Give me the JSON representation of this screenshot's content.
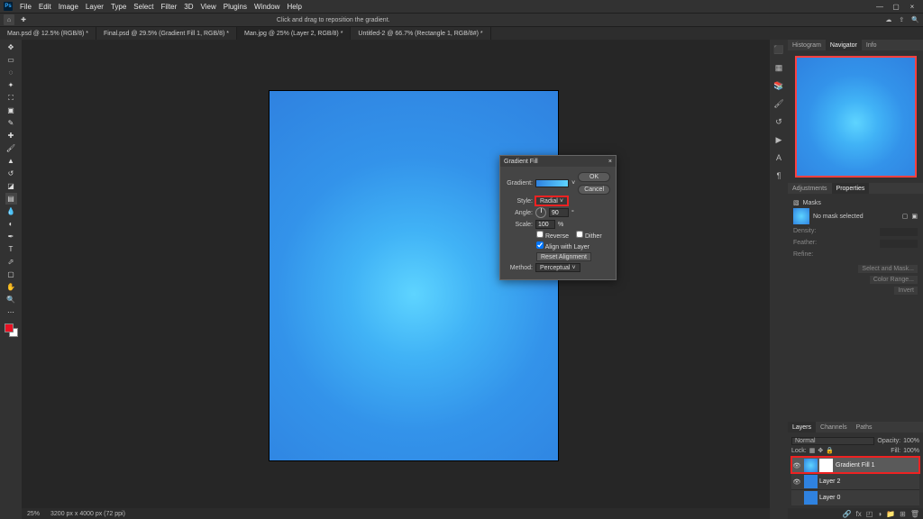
{
  "menu": {
    "items": [
      "File",
      "Edit",
      "Image",
      "Layer",
      "Type",
      "Select",
      "Filter",
      "3D",
      "View",
      "Plugins",
      "Window",
      "Help"
    ],
    "logo": "Ps"
  },
  "options_hint": "Click and drag to reposition the gradient.",
  "tabs": [
    {
      "label": "Man.psd @ 12.5% (RGB/8) *"
    },
    {
      "label": "Final.psd @ 29.5% (Gradient Fill 1, RGB/8) *"
    },
    {
      "label": "Man.jpg @ 25% (Layer 2, RGB/8) *"
    },
    {
      "label": "Untitled-2 @ 66.7% (Rectangle 1, RGB/8#) *"
    }
  ],
  "active_tab": 2,
  "status": {
    "zoom": "25%",
    "doc": "3200 px x 4000 px (72 ppi)"
  },
  "dialog": {
    "title": "Gradient Fill",
    "labels": {
      "gradient": "Gradient:",
      "style": "Style:",
      "angle": "Angle:",
      "scale": "Scale:",
      "reverse": "Reverse",
      "dither": "Dither",
      "align": "Align with Layer",
      "reset": "Reset Alignment",
      "method": "Method:"
    },
    "style": "Radial",
    "angle": "90",
    "scale": "100",
    "scale_suffix": "%",
    "reverse": false,
    "dither": false,
    "align": true,
    "method": "Perceptual",
    "ok": "OK",
    "cancel": "Cancel"
  },
  "navigator_tabs": [
    "Histogram",
    "Navigator",
    "Info"
  ],
  "props_tabs": [
    "Adjustments",
    "Properties"
  ],
  "props": {
    "masks": "Masks",
    "nomask": "No mask selected",
    "density": "Density:",
    "feather": "Feather:",
    "refine": "Refine:",
    "btn1": "Select and Mask...",
    "btn2": "Color Range...",
    "btn3": "Invert"
  },
  "layers_tabs": [
    "Layers",
    "Channels",
    "Paths"
  ],
  "layers": {
    "blend": "Normal",
    "opacity_lbl": "Opacity:",
    "opacity": "100%",
    "fill_lbl": "Fill:",
    "fill": "100%",
    "lock": "Lock:",
    "items": [
      {
        "name": "Gradient Fill 1",
        "type": "grad",
        "active": true
      },
      {
        "name": "Layer 2",
        "type": "img"
      },
      {
        "name": "Layer 0",
        "type": "img"
      }
    ]
  },
  "icons": {
    "search": "🔍",
    "bell": "🔔",
    "cloud": "☁",
    "share": "⇪",
    "close": "×",
    "chev": "˅",
    "home": "⌂",
    "plus": "✚",
    "fx": "fx",
    "trash": "🗑",
    "new": "⊞",
    "mask": "◰",
    "adj": "◑",
    "folder": "📁",
    "link": "🔗"
  }
}
